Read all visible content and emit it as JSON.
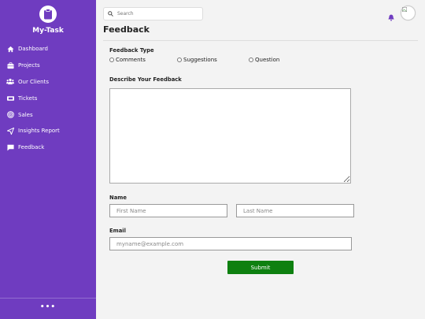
{
  "sidebar": {
    "brand": "My-Task",
    "items": [
      {
        "label": "Dashboard",
        "icon": "home-icon"
      },
      {
        "label": "Projects",
        "icon": "briefcase-icon"
      },
      {
        "label": "Our Clients",
        "icon": "users-icon"
      },
      {
        "label": "Tickets",
        "icon": "ticket-icon"
      },
      {
        "label": "Sales",
        "icon": "target-icon"
      },
      {
        "label": "Insights Report",
        "icon": "send-icon"
      },
      {
        "label": "Feedback",
        "icon": "chat-icon"
      }
    ],
    "more_label": "•••"
  },
  "header": {
    "search_placeholder": "Search"
  },
  "page": {
    "title": "Feedback"
  },
  "form": {
    "feedback_type_label": "Feedback Type",
    "feedback_types": [
      "Comments",
      "Suggestions",
      "Question"
    ],
    "describe_label": "Describe Your Feedback",
    "describe_value": "",
    "name_label": "Name",
    "first_name_placeholder": "First Name",
    "first_name_value": "",
    "last_name_placeholder": "Last Name",
    "last_name_value": "",
    "email_label": "Email",
    "email_placeholder": "myname@example.com",
    "email_value": "",
    "submit_label": "Submit"
  },
  "colors": {
    "sidebar": "#6f3cc0",
    "submit": "#0e8010",
    "bell": "#6f3cc0"
  }
}
